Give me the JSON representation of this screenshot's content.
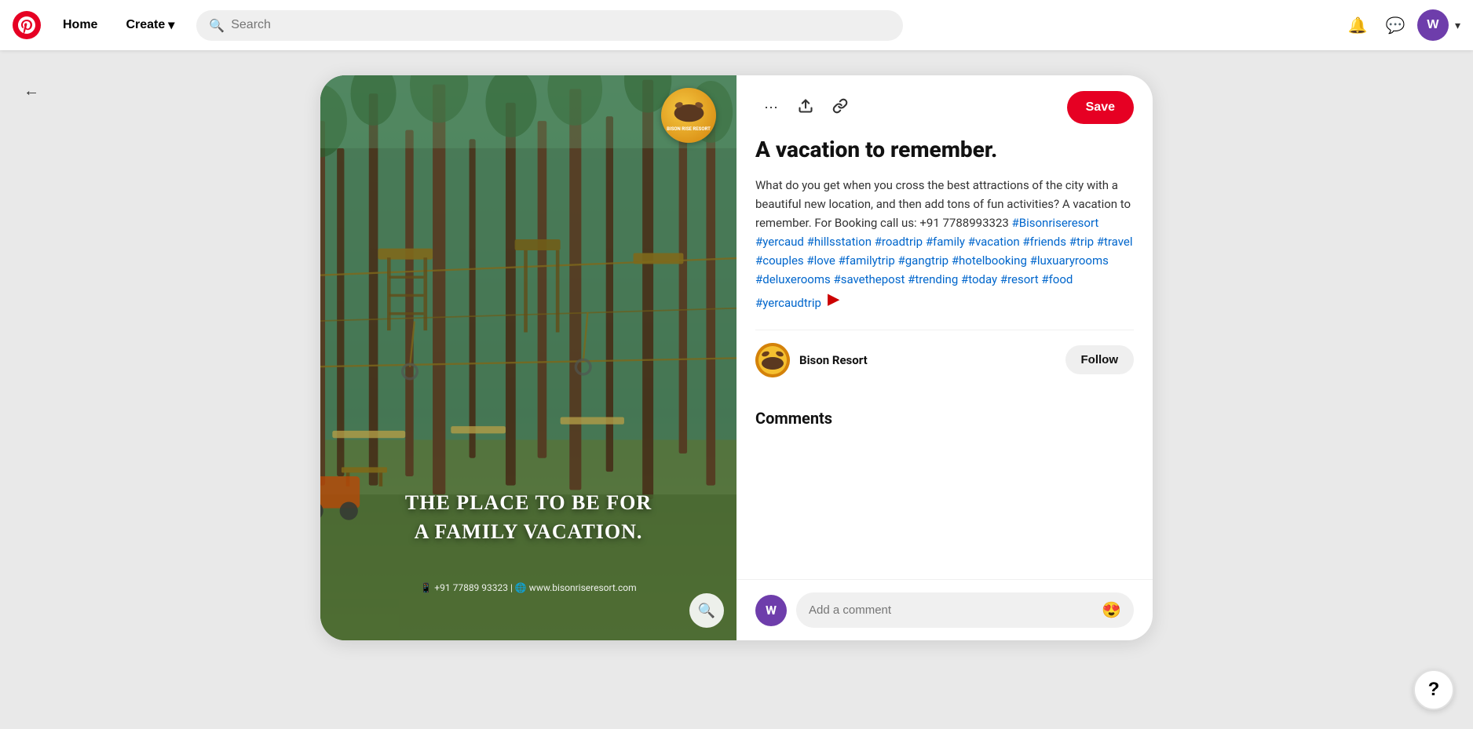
{
  "header": {
    "logo_alt": "Pinterest",
    "nav": {
      "home_label": "Home",
      "create_label": "Create",
      "create_has_dropdown": true
    },
    "search": {
      "placeholder": "Search"
    },
    "user_initial": "W"
  },
  "back_button_label": "←",
  "pin": {
    "image": {
      "overlay_text_line1": "THE PLACE TO BE FOR",
      "overlay_text_line2": "A FAMILY VACATION.",
      "contact_text": "📱 +91 77889 93323  |  🌐  www.bisonriseresort.com",
      "logo_label": "BISON RISE RESORT"
    },
    "actions": {
      "more_icon": "⋯",
      "share_icon": "↑",
      "link_icon": "🔗",
      "save_label": "Save"
    },
    "title": "A vacation to remember.",
    "description_plain": "What do you get when you cross the best attractions of the city with a beautiful new location, and then add tons of fun activities? A vacation to remember. For Booking call us: +91 7788993323 ",
    "hashtags": "#Bisonriseresort #yercaud #hillsstation #roadtrip #family #vacation #friends #trip #travel #couples #love #familytrip #gangtrip #hotelbooking #luxuaryrooms #deluxerooms #savethepost #trending #today #resort #food #yercaudtrip",
    "author": {
      "name": "Bison Resort",
      "follow_label": "Follow"
    },
    "comments": {
      "section_title": "Comments",
      "input_placeholder": "Add a comment",
      "user_initial": "W",
      "emoji": "😍"
    }
  },
  "help_label": "?",
  "nav_arrow": "▶"
}
